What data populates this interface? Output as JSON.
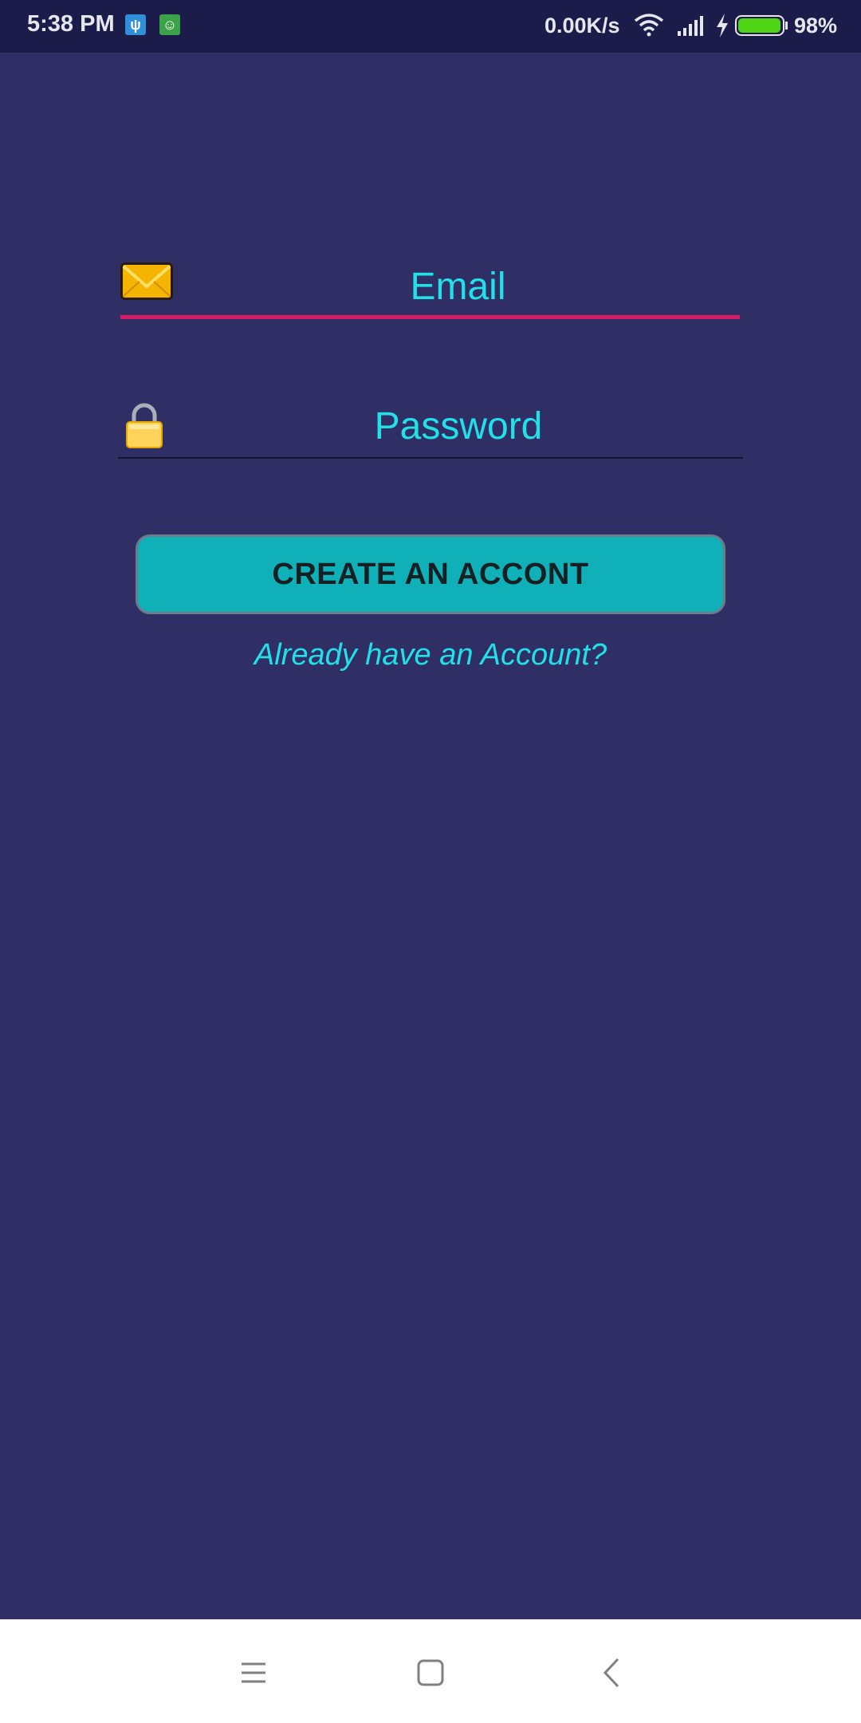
{
  "status_bar": {
    "time": "5:38 PM",
    "net_speed": "0.00K/s",
    "battery_percent": "98%",
    "battery_level": 0.98,
    "icons": [
      "usb-icon",
      "android-debug-icon",
      "wifi-icon",
      "signal-icon",
      "charging-icon",
      "battery-icon"
    ]
  },
  "form": {
    "email": {
      "placeholder": "Email",
      "value": "",
      "icon": "envelope-icon"
    },
    "password": {
      "placeholder": "Password",
      "value": "",
      "icon": "lock-icon"
    },
    "create_button_label": "CREATE AN ACCONT",
    "login_link": "Already have an Account?"
  },
  "nav_bar": {
    "icons": [
      "menu-icon",
      "home-icon",
      "back-icon"
    ]
  },
  "colors": {
    "background": "#2f2f66",
    "status_bar": "#1c1c4a",
    "accent_text": "#22e0e8",
    "email_underline": "#d81b66",
    "button": "#0fb0b8"
  }
}
